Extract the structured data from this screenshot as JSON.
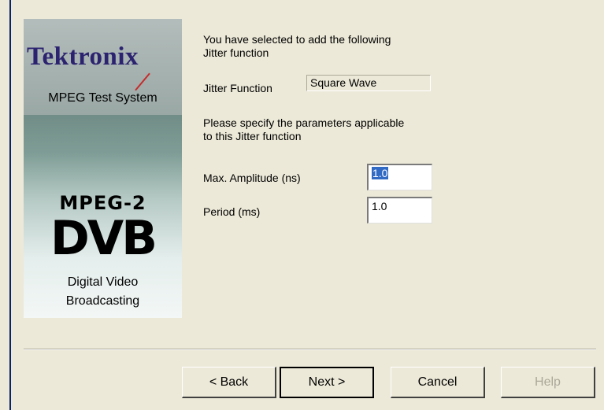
{
  "banner": {
    "logo": "Tektronix",
    "subtitle": "MPEG Test System",
    "mpeg": "MPEG-2",
    "dvb": "DVB",
    "dvb_sub1": "Digital Video",
    "dvb_sub2": "Broadcasting"
  },
  "intro": {
    "line1": "You have selected to add the following",
    "line2": "Jitter function"
  },
  "jitter_function": {
    "label": "Jitter Function",
    "value": "Square Wave"
  },
  "params_intro": {
    "line1": "Please specify the parameters applicable",
    "line2": "to this Jitter function"
  },
  "max_amplitude": {
    "label": "Max. Amplitude (ns)",
    "value": "1.0"
  },
  "period": {
    "label": "Period (ms)",
    "value": "1.0"
  },
  "buttons": {
    "back": "< Back",
    "next": "Next >",
    "cancel": "Cancel",
    "help": "Help"
  }
}
